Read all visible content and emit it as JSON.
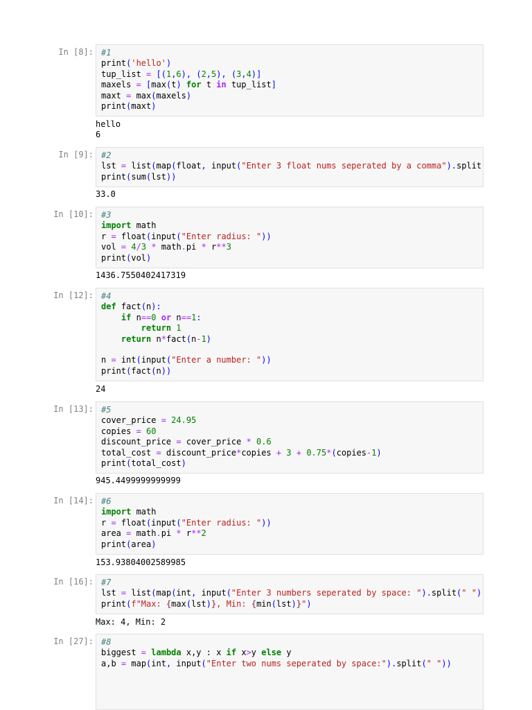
{
  "cells": [
    {
      "prompt": "In [8]:",
      "code": [
        [
          [
            "c",
            "#1"
          ]
        ],
        [
          [
            "n",
            "print"
          ],
          [
            "p",
            "("
          ],
          [
            "s",
            "'hello'"
          ],
          [
            "p",
            ")"
          ]
        ],
        [
          [
            "n",
            "tup_list "
          ],
          [
            "o",
            "="
          ],
          [
            "n",
            " "
          ],
          [
            "p",
            "[("
          ],
          [
            "m",
            "1"
          ],
          [
            "p",
            ","
          ],
          [
            "m",
            "6"
          ],
          [
            "p",
            "), ("
          ],
          [
            "m",
            "2"
          ],
          [
            "p",
            ","
          ],
          [
            "m",
            "5"
          ],
          [
            "p",
            "), ("
          ],
          [
            "m",
            "3"
          ],
          [
            "p",
            ","
          ],
          [
            "m",
            "4"
          ],
          [
            "p",
            ")]"
          ]
        ],
        [
          [
            "n",
            "maxels "
          ],
          [
            "o",
            "="
          ],
          [
            "n",
            " "
          ],
          [
            "p",
            "["
          ],
          [
            "n",
            "max"
          ],
          [
            "p",
            "("
          ],
          [
            "n",
            "t"
          ],
          [
            "p",
            ")"
          ],
          [
            "n",
            " "
          ],
          [
            "k",
            "for"
          ],
          [
            "n",
            " t "
          ],
          [
            "ow",
            "in"
          ],
          [
            "n",
            " tup_list"
          ],
          [
            "p",
            "]"
          ]
        ],
        [
          [
            "n",
            "maxt "
          ],
          [
            "o",
            "="
          ],
          [
            "n",
            " max"
          ],
          [
            "p",
            "("
          ],
          [
            "n",
            "maxels"
          ],
          [
            "p",
            ")"
          ]
        ],
        [
          [
            "n",
            "print"
          ],
          [
            "p",
            "("
          ],
          [
            "n",
            "maxt"
          ],
          [
            "p",
            ")"
          ]
        ]
      ],
      "output": [
        "hello",
        "6"
      ]
    },
    {
      "prompt": "In [9]:",
      "code": [
        [
          [
            "c",
            "#2"
          ]
        ],
        [
          [
            "n",
            "lst "
          ],
          [
            "o",
            "="
          ],
          [
            "n",
            " list"
          ],
          [
            "p",
            "("
          ],
          [
            "n",
            "map"
          ],
          [
            "p",
            "("
          ],
          [
            "n",
            "float"
          ],
          [
            "p",
            ", "
          ],
          [
            "n",
            "input"
          ],
          [
            "p",
            "("
          ],
          [
            "s",
            "\"Enter 3 float nums seperated by a comma\""
          ],
          [
            "p",
            ")."
          ],
          [
            "n",
            "split"
          ],
          [
            "p",
            "("
          ],
          [
            "s",
            "\",\""
          ],
          [
            "p",
            ")))"
          ]
        ],
        [
          [
            "n",
            "print"
          ],
          [
            "p",
            "("
          ],
          [
            "n",
            "sum"
          ],
          [
            "p",
            "("
          ],
          [
            "n",
            "lst"
          ],
          [
            "p",
            "))"
          ]
        ]
      ],
      "output": [
        "33.0"
      ]
    },
    {
      "prompt": "In [10]:",
      "code": [
        [
          [
            "c",
            "#3"
          ]
        ],
        [
          [
            "k",
            "import"
          ],
          [
            "n",
            " math"
          ]
        ],
        [
          [
            "n",
            "r "
          ],
          [
            "o",
            "="
          ],
          [
            "n",
            " float"
          ],
          [
            "p",
            "("
          ],
          [
            "n",
            "input"
          ],
          [
            "p",
            "("
          ],
          [
            "s",
            "\"Enter radius: \""
          ],
          [
            "p",
            "))"
          ]
        ],
        [
          [
            "n",
            "vol "
          ],
          [
            "o",
            "="
          ],
          [
            "n",
            " "
          ],
          [
            "m",
            "4"
          ],
          [
            "o",
            "/"
          ],
          [
            "m",
            "3"
          ],
          [
            "n",
            " "
          ],
          [
            "o",
            "*"
          ],
          [
            "n",
            " math"
          ],
          [
            "o",
            "."
          ],
          [
            "n",
            "pi "
          ],
          [
            "o",
            "*"
          ],
          [
            "n",
            " r"
          ],
          [
            "o",
            "**"
          ],
          [
            "m",
            "3"
          ]
        ],
        [
          [
            "n",
            "print"
          ],
          [
            "p",
            "("
          ],
          [
            "n",
            "vol"
          ],
          [
            "p",
            ")"
          ]
        ]
      ],
      "output": [
        "1436.7550402417319"
      ]
    },
    {
      "prompt": "In [12]:",
      "code": [
        [
          [
            "c",
            "#4"
          ]
        ],
        [
          [
            "k",
            "def"
          ],
          [
            "n",
            " fact"
          ],
          [
            "p",
            "("
          ],
          [
            "n",
            "n"
          ],
          [
            "p",
            "):"
          ]
        ],
        [
          [
            "n",
            "    "
          ],
          [
            "k",
            "if"
          ],
          [
            "n",
            " n"
          ],
          [
            "o",
            "=="
          ],
          [
            "m",
            "0"
          ],
          [
            "n",
            " "
          ],
          [
            "ow",
            "or"
          ],
          [
            "n",
            " n"
          ],
          [
            "o",
            "=="
          ],
          [
            "m",
            "1"
          ],
          [
            "p",
            ":"
          ]
        ],
        [
          [
            "n",
            "        "
          ],
          [
            "k",
            "return"
          ],
          [
            "n",
            " "
          ],
          [
            "m",
            "1"
          ]
        ],
        [
          [
            "n",
            "    "
          ],
          [
            "k",
            "return"
          ],
          [
            "n",
            " n"
          ],
          [
            "o",
            "*"
          ],
          [
            "n",
            "fact"
          ],
          [
            "p",
            "("
          ],
          [
            "n",
            "n"
          ],
          [
            "o",
            "-"
          ],
          [
            "m",
            "1"
          ],
          [
            "p",
            ")"
          ]
        ],
        [],
        [
          [
            "n",
            "n "
          ],
          [
            "o",
            "="
          ],
          [
            "n",
            " int"
          ],
          [
            "p",
            "("
          ],
          [
            "n",
            "input"
          ],
          [
            "p",
            "("
          ],
          [
            "s",
            "\"Enter a number: \""
          ],
          [
            "p",
            "))"
          ]
        ],
        [
          [
            "n",
            "print"
          ],
          [
            "p",
            "("
          ],
          [
            "n",
            "fact"
          ],
          [
            "p",
            "("
          ],
          [
            "n",
            "n"
          ],
          [
            "p",
            "))"
          ]
        ]
      ],
      "output": [
        "24"
      ]
    },
    {
      "prompt": "In [13]:",
      "code": [
        [
          [
            "c",
            "#5"
          ]
        ],
        [
          [
            "n",
            "cover_price "
          ],
          [
            "o",
            "="
          ],
          [
            "n",
            " "
          ],
          [
            "m",
            "24.95"
          ]
        ],
        [
          [
            "n",
            "copies "
          ],
          [
            "o",
            "="
          ],
          [
            "n",
            " "
          ],
          [
            "m",
            "60"
          ]
        ],
        [
          [
            "n",
            "discount_price "
          ],
          [
            "o",
            "="
          ],
          [
            "n",
            " cover_price "
          ],
          [
            "o",
            "*"
          ],
          [
            "n",
            " "
          ],
          [
            "m",
            "0.6"
          ]
        ],
        [
          [
            "n",
            "total_cost "
          ],
          [
            "o",
            "="
          ],
          [
            "n",
            " discount_price"
          ],
          [
            "o",
            "*"
          ],
          [
            "n",
            "copies "
          ],
          [
            "o",
            "+"
          ],
          [
            "n",
            " "
          ],
          [
            "m",
            "3"
          ],
          [
            "n",
            " "
          ],
          [
            "o",
            "+"
          ],
          [
            "n",
            " "
          ],
          [
            "m",
            "0.75"
          ],
          [
            "o",
            "*"
          ],
          [
            "p",
            "("
          ],
          [
            "n",
            "copies"
          ],
          [
            "o",
            "-"
          ],
          [
            "m",
            "1"
          ],
          [
            "p",
            ")"
          ]
        ],
        [
          [
            "n",
            "print"
          ],
          [
            "p",
            "("
          ],
          [
            "n",
            "total_cost"
          ],
          [
            "p",
            ")"
          ]
        ]
      ],
      "output": [
        "945.4499999999999"
      ]
    },
    {
      "prompt": "In [14]:",
      "code": [
        [
          [
            "c",
            "#6"
          ]
        ],
        [
          [
            "k",
            "import"
          ],
          [
            "n",
            " math"
          ]
        ],
        [
          [
            "n",
            "r "
          ],
          [
            "o",
            "="
          ],
          [
            "n",
            " float"
          ],
          [
            "p",
            "("
          ],
          [
            "n",
            "input"
          ],
          [
            "p",
            "("
          ],
          [
            "s",
            "\"Enter radius: \""
          ],
          [
            "p",
            "))"
          ]
        ],
        [
          [
            "n",
            "area "
          ],
          [
            "o",
            "="
          ],
          [
            "n",
            " math"
          ],
          [
            "o",
            "."
          ],
          [
            "n",
            "pi "
          ],
          [
            "o",
            "*"
          ],
          [
            "n",
            " r"
          ],
          [
            "o",
            "**"
          ],
          [
            "m",
            "2"
          ]
        ],
        [
          [
            "n",
            "print"
          ],
          [
            "p",
            "("
          ],
          [
            "n",
            "area"
          ],
          [
            "p",
            ")"
          ]
        ]
      ],
      "output": [
        "153.93804002589985"
      ]
    },
    {
      "prompt": "In [16]:",
      "code": [
        [
          [
            "c",
            "#7"
          ]
        ],
        [
          [
            "n",
            "lst "
          ],
          [
            "o",
            "="
          ],
          [
            "n",
            " list"
          ],
          [
            "p",
            "("
          ],
          [
            "n",
            "map"
          ],
          [
            "p",
            "("
          ],
          [
            "n",
            "int"
          ],
          [
            "p",
            ", "
          ],
          [
            "n",
            "input"
          ],
          [
            "p",
            "("
          ],
          [
            "s",
            "\"Enter 3 numbers seperated by space: \""
          ],
          [
            "p",
            ")."
          ],
          [
            "n",
            "split"
          ],
          [
            "p",
            "("
          ],
          [
            "s",
            "\" \""
          ],
          [
            "p",
            ")))"
          ]
        ],
        [
          [
            "n",
            "print"
          ],
          [
            "p",
            "("
          ],
          [
            "s",
            "f\"Max: "
          ],
          [
            "si",
            "{"
          ],
          [
            "n",
            "max"
          ],
          [
            "p",
            "("
          ],
          [
            "n",
            "lst"
          ],
          [
            "p",
            ")"
          ],
          [
            "si",
            "}"
          ],
          [
            "s",
            ", Min: "
          ],
          [
            "si",
            "{"
          ],
          [
            "n",
            "min"
          ],
          [
            "p",
            "("
          ],
          [
            "n",
            "lst"
          ],
          [
            "p",
            ")"
          ],
          [
            "si",
            "}"
          ],
          [
            "s",
            "\""
          ],
          [
            "p",
            ")"
          ]
        ]
      ],
      "output": [
        "Max: 4, Min: 2"
      ]
    },
    {
      "prompt": "In [27]:",
      "code": [
        [
          [
            "c",
            "#8"
          ]
        ],
        [
          [
            "n",
            "biggest "
          ],
          [
            "o",
            "="
          ],
          [
            "n",
            " "
          ],
          [
            "k",
            "lambda"
          ],
          [
            "n",
            " x,y : x "
          ],
          [
            "k",
            "if"
          ],
          [
            "n",
            " x"
          ],
          [
            "o",
            "&gt;"
          ],
          [
            "n",
            "y "
          ],
          [
            "k",
            "else"
          ],
          [
            "n",
            " y"
          ]
        ],
        [
          [
            "n",
            "a,b "
          ],
          [
            "o",
            "="
          ],
          [
            "n",
            " map"
          ],
          [
            "p",
            "("
          ],
          [
            "n",
            "int"
          ],
          [
            "p",
            ", "
          ],
          [
            "n",
            "input"
          ],
          [
            "p",
            "("
          ],
          [
            "s",
            "\"Enter two nums seperated by space:\""
          ],
          [
            "p",
            ")."
          ],
          [
            "n",
            "split"
          ],
          [
            "p",
            "("
          ],
          [
            "s",
            "\" \""
          ],
          [
            "p",
            "))"
          ]
        ]
      ],
      "output": []
    }
  ]
}
